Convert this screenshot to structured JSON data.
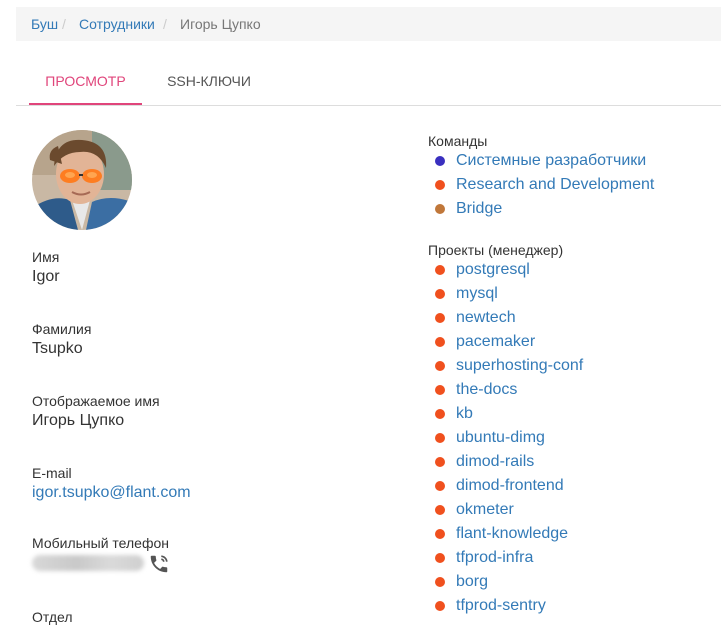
{
  "breadcrumb": {
    "items": [
      "Буш",
      "Сотрудники",
      "Игорь Цупко"
    ],
    "separator": "/"
  },
  "tabs": [
    {
      "label": "ПРОСМОТР"
    },
    {
      "label": "SSH-КЛЮЧИ"
    }
  ],
  "profile": {
    "fields": [
      {
        "label": "Имя",
        "value": "Igor"
      },
      {
        "label": "Фамилия",
        "value": "Tsupko"
      },
      {
        "label": "Отображаемое имя",
        "value": "Игорь Цупко"
      },
      {
        "label": "E-mail",
        "value": "igor.tsupko@flant.com"
      },
      {
        "label": "Мобильный телефон"
      },
      {
        "label": "Отдел"
      }
    ],
    "phone_icon": "phone-call-icon"
  },
  "teams": {
    "heading": "Команды",
    "items": [
      {
        "label": "Системные разработчики",
        "color": "#3a2fbf"
      },
      {
        "label": "Research and Development",
        "color": "#f0501e"
      },
      {
        "label": "Bridge",
        "color": "#c0773a"
      }
    ]
  },
  "projects": {
    "heading": "Проекты (менеджер)",
    "items": [
      {
        "label": "postgresql",
        "color": "#f0501e"
      },
      {
        "label": "mysql",
        "color": "#f0501e"
      },
      {
        "label": "newtech",
        "color": "#f0501e"
      },
      {
        "label": "pacemaker",
        "color": "#f0501e"
      },
      {
        "label": "superhosting-conf",
        "color": "#f0501e"
      },
      {
        "label": "the-docs",
        "color": "#f0501e"
      },
      {
        "label": "kb",
        "color": "#f0501e"
      },
      {
        "label": "ubuntu-dimg",
        "color": "#f0501e"
      },
      {
        "label": "dimod-rails",
        "color": "#f0501e"
      },
      {
        "label": "dimod-frontend",
        "color": "#f0501e"
      },
      {
        "label": "okmeter",
        "color": "#f0501e"
      },
      {
        "label": "flant-knowledge",
        "color": "#f0501e"
      },
      {
        "label": "tfprod-infra",
        "color": "#f0501e"
      },
      {
        "label": "borg",
        "color": "#f0501e"
      },
      {
        "label": "tfprod-sentry",
        "color": "#f0501e"
      }
    ]
  }
}
